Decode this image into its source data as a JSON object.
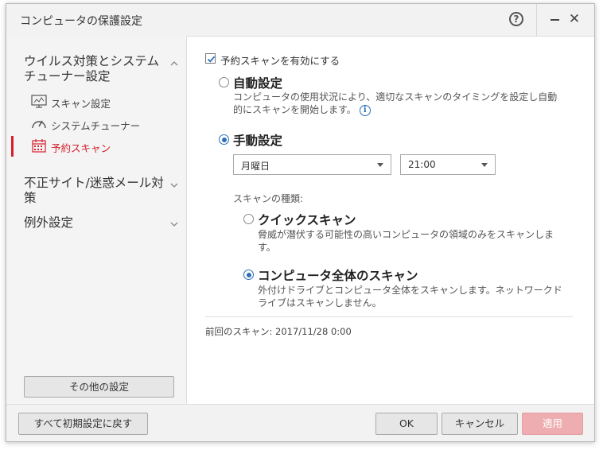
{
  "window": {
    "title": "コンピュータの保護設定",
    "help_label": "?",
    "close_label": "✕"
  },
  "sidebar": {
    "groups": [
      {
        "label": "ウイルス対策とシステムチューナー設定",
        "expanded": true
      },
      {
        "label": "不正サイト/迷惑メール対策",
        "expanded": false
      },
      {
        "label": "例外設定",
        "expanded": false
      }
    ],
    "sub_items": [
      {
        "label": "スキャン設定",
        "icon": "monitor-icon",
        "active": false
      },
      {
        "label": "システムチューナー",
        "icon": "gauge-icon",
        "active": false
      },
      {
        "label": "予約スキャン",
        "icon": "calendar-icon",
        "active": true
      }
    ],
    "other_settings_label": "その他の設定"
  },
  "main": {
    "enable_checkbox": {
      "label": "予約スキャンを有効にする",
      "checked": true
    },
    "auto": {
      "title": "自動設定",
      "description": "コンピュータの使用状況により、適切なスキャンのタイミングを設定し自動的にスキャンを開始します。",
      "info_label": "i",
      "selected": false
    },
    "manual": {
      "title": "手動設定",
      "selected": true,
      "day_value": "月曜日",
      "time_value": "21:00"
    },
    "scan_type_label": "スキャンの種類:",
    "quick": {
      "title": "クイックスキャン",
      "description": "脅威が潜伏する可能性の高いコンピュータの領域のみをスキャンします。",
      "selected": false
    },
    "full": {
      "title": "コンピュータ全体のスキャン",
      "description": "外付けドライブとコンピュータ全体をスキャンします。ネットワークドライブはスキャンしません。",
      "selected": true
    },
    "last_scan": "前回のスキャン: 2017/11/28 0:00"
  },
  "footer": {
    "reset_label": "すべて初期設定に戻す",
    "ok_label": "OK",
    "cancel_label": "キャンセル",
    "apply_label": "適用"
  },
  "colors": {
    "accent_red": "#d61f2c",
    "radio_blue": "#2d6fb8",
    "apply_disabled": "#eeaeb1"
  }
}
